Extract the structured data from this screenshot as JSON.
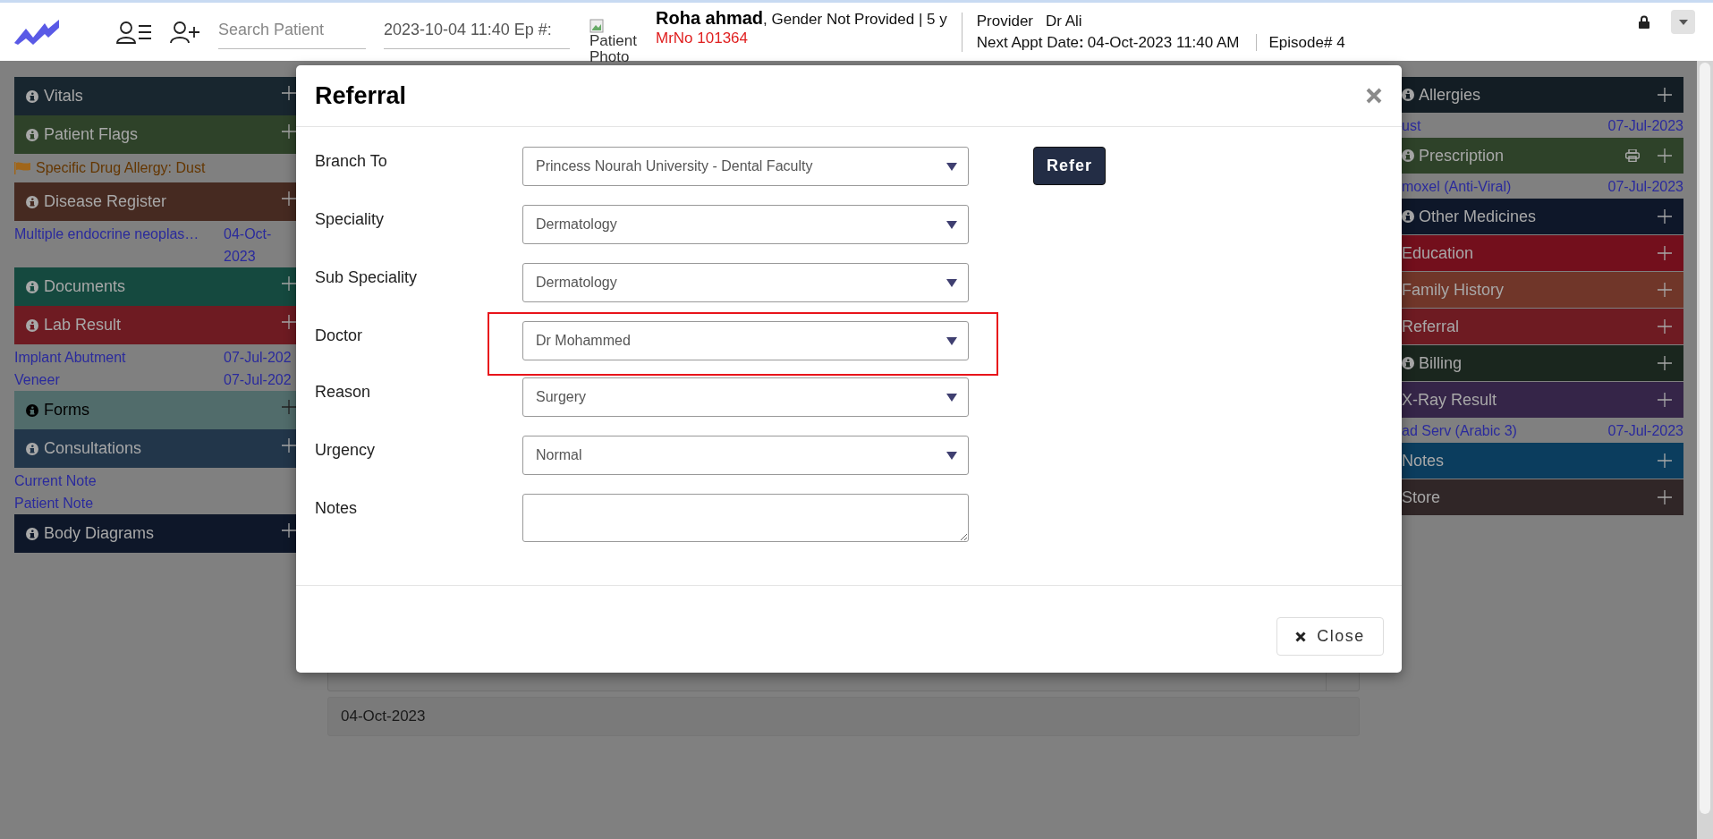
{
  "header": {
    "search": {
      "placeholder": "Search Patient"
    },
    "episode_field": {
      "value": "2023-10-04 11:40 Ep #:"
    },
    "photo_alt": "Patient Photo",
    "patient": {
      "name": "Roha ahmad",
      "details": ", Gender Not Provided | 5 y",
      "mrno": "MrNo 101364"
    },
    "provider_label": "Provider",
    "provider": "Dr Ali",
    "next_appt_label": "Next Appt Date**:**",
    "next_appt": "04-Oct-2023 11:40 AM",
    "episode": "Episode# 4"
  },
  "left_sections": [
    {
      "title": "Vitals",
      "color": "#18262f",
      "info": true,
      "dark_text": false
    },
    {
      "title": "Patient Flags",
      "color": "#2e4229",
      "info": true,
      "dark_text": false,
      "items": [
        {
          "kind": "flag",
          "name": "Specific Drug Allergy: Dust"
        }
      ]
    },
    {
      "title": "Disease Register",
      "color": "#462a21",
      "info": true,
      "dark_text": false,
      "items": [
        {
          "kind": "link",
          "name": "Multiple endocrine neoplas…",
          "date": "04-Oct-2023"
        }
      ]
    },
    {
      "title": "Documents",
      "color": "#15493f",
      "info": true,
      "dark_text": false
    },
    {
      "title": "Lab Result",
      "color": "#6e1b22",
      "info": true,
      "dark_text": false,
      "items": [
        {
          "kind": "link",
          "name": "Implant Abutment",
          "date": "07-Jul-202"
        },
        {
          "kind": "link",
          "name": "Veneer",
          "date": "07-Jul-202"
        }
      ]
    },
    {
      "title": "Forms",
      "color": "#516c6b",
      "info": true,
      "dark_text": true
    },
    {
      "title": "Consultations",
      "color": "#22364a",
      "info": true,
      "dark_text": false,
      "items": [
        {
          "kind": "link",
          "name": "Current Note"
        },
        {
          "kind": "link",
          "name": "Patient Note"
        }
      ]
    },
    {
      "title": "Body Diagrams",
      "color": "#0e1729",
      "info": true,
      "dark_text": false
    }
  ],
  "right_sections": [
    {
      "title": "Allergies",
      "color": "#131d24",
      "info": true,
      "print": false,
      "items": [
        {
          "kind": "link",
          "name": "ust",
          "date": "07-Jul-2023"
        }
      ]
    },
    {
      "title": "Prescription",
      "color": "#2e4229",
      "info": true,
      "print": true,
      "items": [
        {
          "kind": "link",
          "name": "moxel (Anti-Viral)",
          "date": "07-Jul-2023"
        }
      ]
    },
    {
      "title": "Other Medicines",
      "color": "#0e1729",
      "info": true,
      "print": false
    },
    {
      "title": "Education",
      "color": "#730f1c",
      "info": false,
      "print": false
    },
    {
      "title": "Family History",
      "color": "#703629",
      "info": false,
      "print": false
    },
    {
      "title": "Referral",
      "color": "#6e1b22",
      "info": false,
      "print": false
    },
    {
      "title": "Billing",
      "color": "#1a261e",
      "info": true,
      "print": false
    },
    {
      "title": "X-Ray Result",
      "color": "#352548",
      "info": false,
      "print": false,
      "items": [
        {
          "kind": "link",
          "name": "ad Serv (Arabic 3)",
          "date": "07-Jul-2023"
        }
      ]
    },
    {
      "title": "Notes",
      "color": "#0b3d5e",
      "info": false,
      "print": false
    },
    {
      "title": "Store",
      "color": "#302627",
      "info": false,
      "print": false
    }
  ],
  "center": {
    "date": "04-Oct-2023"
  },
  "modal": {
    "title": "Referral",
    "refer_button": "Refer",
    "close_button": "Close",
    "fields": [
      {
        "label": "Branch To",
        "kind": "select",
        "value": "Princess Nourah University - Dental Faculty",
        "highlighted": false
      },
      {
        "label": "Speciality",
        "kind": "select",
        "value": "Dermatology",
        "highlighted": false
      },
      {
        "label": "Sub Speciality",
        "kind": "select",
        "value": "Dermatology",
        "highlighted": false
      },
      {
        "label": "Doctor",
        "kind": "select",
        "value": "Dr Mohammed",
        "highlighted": true
      },
      {
        "label": "Reason",
        "kind": "select",
        "value": "Surgery",
        "highlighted": false
      },
      {
        "label": "Urgency",
        "kind": "select",
        "value": "Normal",
        "highlighted": false
      },
      {
        "label": "Notes",
        "kind": "textarea",
        "highlighted": false
      }
    ]
  }
}
